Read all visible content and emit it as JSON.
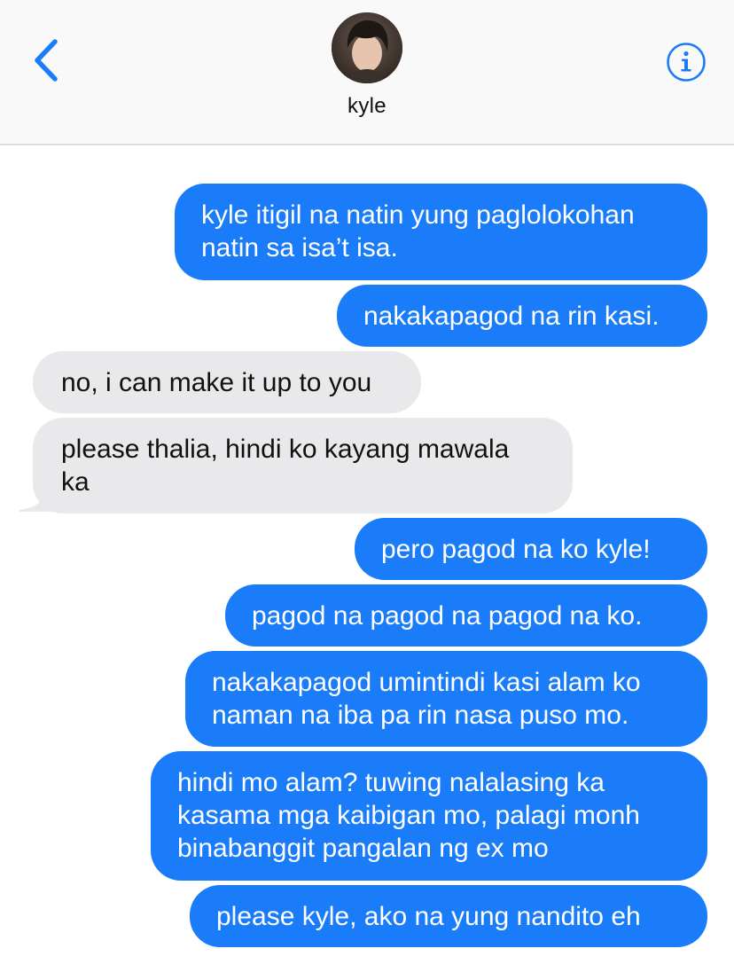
{
  "header": {
    "contact_name": "kyle"
  },
  "icons": {
    "back": "chevron-left-icon",
    "info": "info-circle-icon"
  },
  "colors": {
    "sent_bubble": "#1a7cf8",
    "received_bubble": "#e9e9eb",
    "accent": "#1a7cf8"
  },
  "messages": [
    {
      "sender": "me",
      "lines": [
        "kyle itigil na natin yung paglolokohan",
        "natin sa isa’t isa."
      ]
    },
    {
      "sender": "me",
      "lines": [
        "nakakapagod na rin kasi."
      ]
    },
    {
      "sender": "kyle",
      "lines": [
        "no, i can make it up to you"
      ]
    },
    {
      "sender": "kyle",
      "lines": [
        "please thalia, hindi ko kayang mawala",
        "ka"
      ]
    },
    {
      "sender": "me",
      "lines": [
        "pero pagod na ko kyle!"
      ]
    },
    {
      "sender": "me",
      "lines": [
        "pagod na pagod na pagod na ko."
      ]
    },
    {
      "sender": "me",
      "lines": [
        "nakakapagod umintindi kasi alam ko",
        "naman na iba pa rin nasa puso mo."
      ]
    },
    {
      "sender": "me",
      "lines": [
        "hindi mo alam? tuwing nalalasing ka",
        "kasama mga kaibigan mo, palagi monh",
        "binabanggit pangalan ng ex mo"
      ]
    },
    {
      "sender": "me",
      "lines": [
        "please kyle, ako na yung nandito eh"
      ]
    }
  ]
}
